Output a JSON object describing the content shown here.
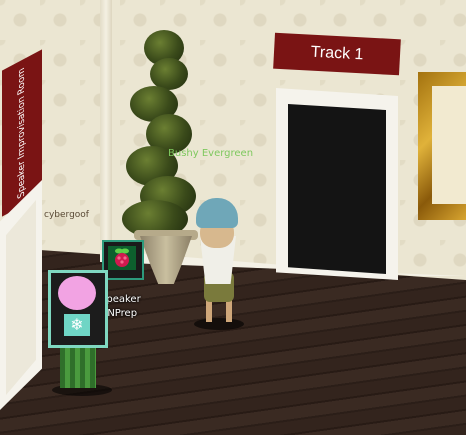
{
  "scene": {
    "signs": {
      "track": "Track 1",
      "speaker": "Speaker Improvisation Room"
    },
    "players": [
      {
        "name": "Bushy Evergreen",
        "color": "#7ec85e"
      },
      {
        "name": "cybergoof"
      }
    ],
    "terminal_label": {
      "line1": "Speaker",
      "line2": "UNPrep"
    },
    "colors": {
      "banner": "#7a1414",
      "wall": "#ebe6d2",
      "floor": "#2b1e18"
    }
  }
}
